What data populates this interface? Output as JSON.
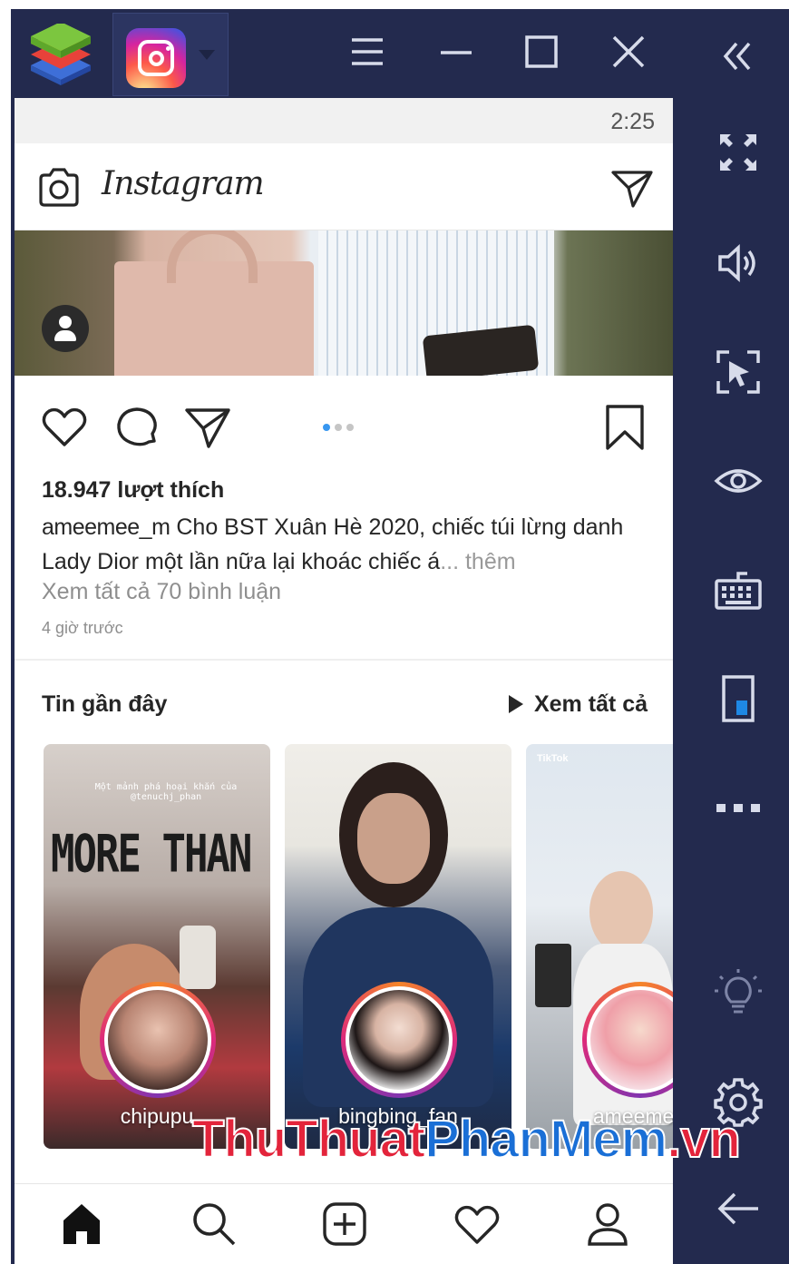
{
  "emulator": {
    "app_tab": "instagram-icon",
    "window_controls": [
      "menu-icon",
      "minimize-icon",
      "maximize-icon",
      "close-icon"
    ],
    "collapse": "double-chevron-left-icon",
    "sidebar_tools": [
      "fullscreen-icon",
      "volume-icon",
      "pointer-icon",
      "eye-icon",
      "keyboard-icon",
      "phone-icon",
      "more-icon",
      "lightbulb-icon",
      "gear-icon",
      "back-arrow-icon"
    ],
    "accent": "#232a4e"
  },
  "status": {
    "time": "2:25"
  },
  "header": {
    "wordmark": "Instagram"
  },
  "post": {
    "likes": "18.947 lượt thích",
    "username": "ameemee_m",
    "caption_text": "Cho BST Xuân Hè 2020, chiếc túi lừng danh Lady Dior một lần nữa lại khoác chiếc á",
    "more": "... thêm",
    "view_comments": "Xem tất cả 70 bình luận",
    "time_ago": "4 giờ trước",
    "carousel_total": 3,
    "carousel_active": 1
  },
  "recent": {
    "title": "Tin gần đây",
    "see_all": "Xem tất cả",
    "stories": [
      {
        "name": "chipupu",
        "overlay_big": "MORE THAN",
        "overlay_small": "Một mảnh phá hoại khắn của @tenuchj_phan"
      },
      {
        "name": "bingbing_fan"
      },
      {
        "name": "ameemee",
        "overlay_tag": "TikTok"
      }
    ]
  },
  "watermark": {
    "part1": "ThuThuat",
    "part2": "PhanMem",
    "part3": ".vn"
  },
  "colors": {
    "accent_blue": "#3897f0",
    "watermark_red": "#e3243b",
    "watermark_blue": "#1a6fd6"
  }
}
